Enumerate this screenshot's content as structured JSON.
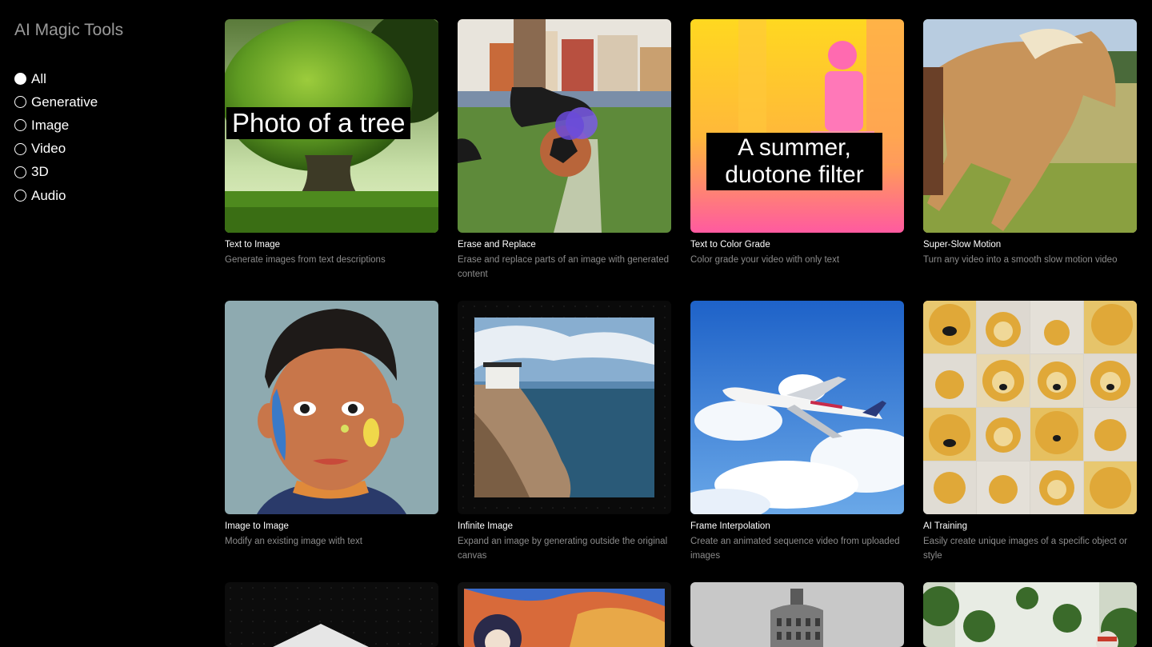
{
  "sidebar": {
    "title": "AI Magic Tools",
    "filters": [
      {
        "label": "All",
        "selected": true
      },
      {
        "label": "Generative",
        "selected": false
      },
      {
        "label": "Image",
        "selected": false
      },
      {
        "label": "Video",
        "selected": false
      },
      {
        "label": "3D",
        "selected": false
      },
      {
        "label": "Audio",
        "selected": false
      }
    ]
  },
  "tools": [
    {
      "title": "Text to Image",
      "description": "Generate images from text descriptions",
      "overlay": "Photo of a tree"
    },
    {
      "title": "Erase and Replace",
      "description": "Erase and replace parts of an image with generated content"
    },
    {
      "title": "Text to Color Grade",
      "description": "Color grade your video with only text",
      "overlay_line1": "A summer,",
      "overlay_line2": "duotone filter"
    },
    {
      "title": "Super-Slow Motion",
      "description": "Turn any video into a smooth slow motion video"
    },
    {
      "title": "Image to Image",
      "description": "Modify an existing image with text"
    },
    {
      "title": "Infinite Image",
      "description": "Expand an image by generating outside the original canvas"
    },
    {
      "title": "Frame Interpolation",
      "description": "Create an animated sequence video from uploaded images"
    },
    {
      "title": "AI Training",
      "description": "Easily create unique images of a specific object or style"
    }
  ],
  "colors": {
    "background": "#000000",
    "title_gray": "#9a9a9a",
    "description_gray": "#8c8c8c"
  }
}
